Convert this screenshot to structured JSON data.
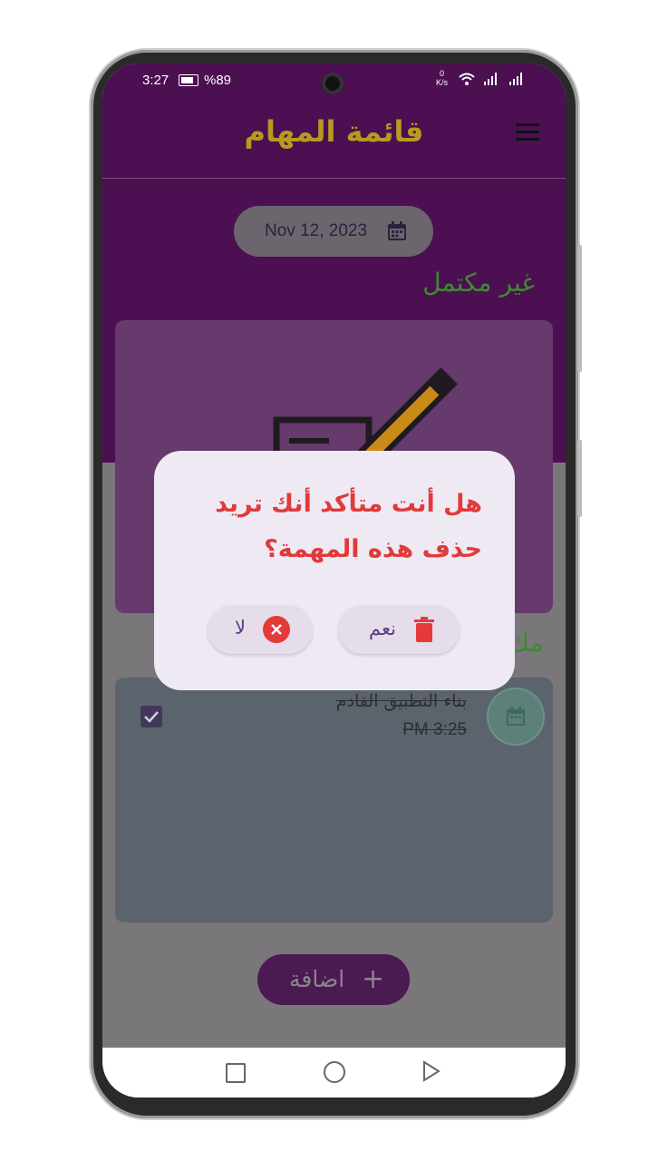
{
  "status_bar": {
    "time": "3:27",
    "battery": "%89",
    "net_speed_value": "0",
    "net_speed_unit": "K/s"
  },
  "app_bar": {
    "title": "قائمة المهام"
  },
  "date_chip": {
    "date": "Nov 12, 2023"
  },
  "sections": {
    "incomplete_title": "غير مكتمل",
    "complete_title_partial": "مك"
  },
  "task": {
    "title": "بناء التطبيق القادم",
    "time": "PM 3:25",
    "checked": true
  },
  "add_button": {
    "label": "اضافة",
    "icon": "plus-icon"
  },
  "dialog": {
    "message": "هل أنت متأكد أنك تريد حذف هذه المهمة؟",
    "yes_label": "نعم",
    "no_label": "لا",
    "yes_icon": "trash-icon",
    "no_icon": "cancel-icon"
  },
  "colors": {
    "primary": "#4b0f52",
    "title_gold": "#b79a1e",
    "section_green": "#3f8a33",
    "danger_red": "#e03a3a",
    "dialog_bg": "#efe9f4"
  }
}
